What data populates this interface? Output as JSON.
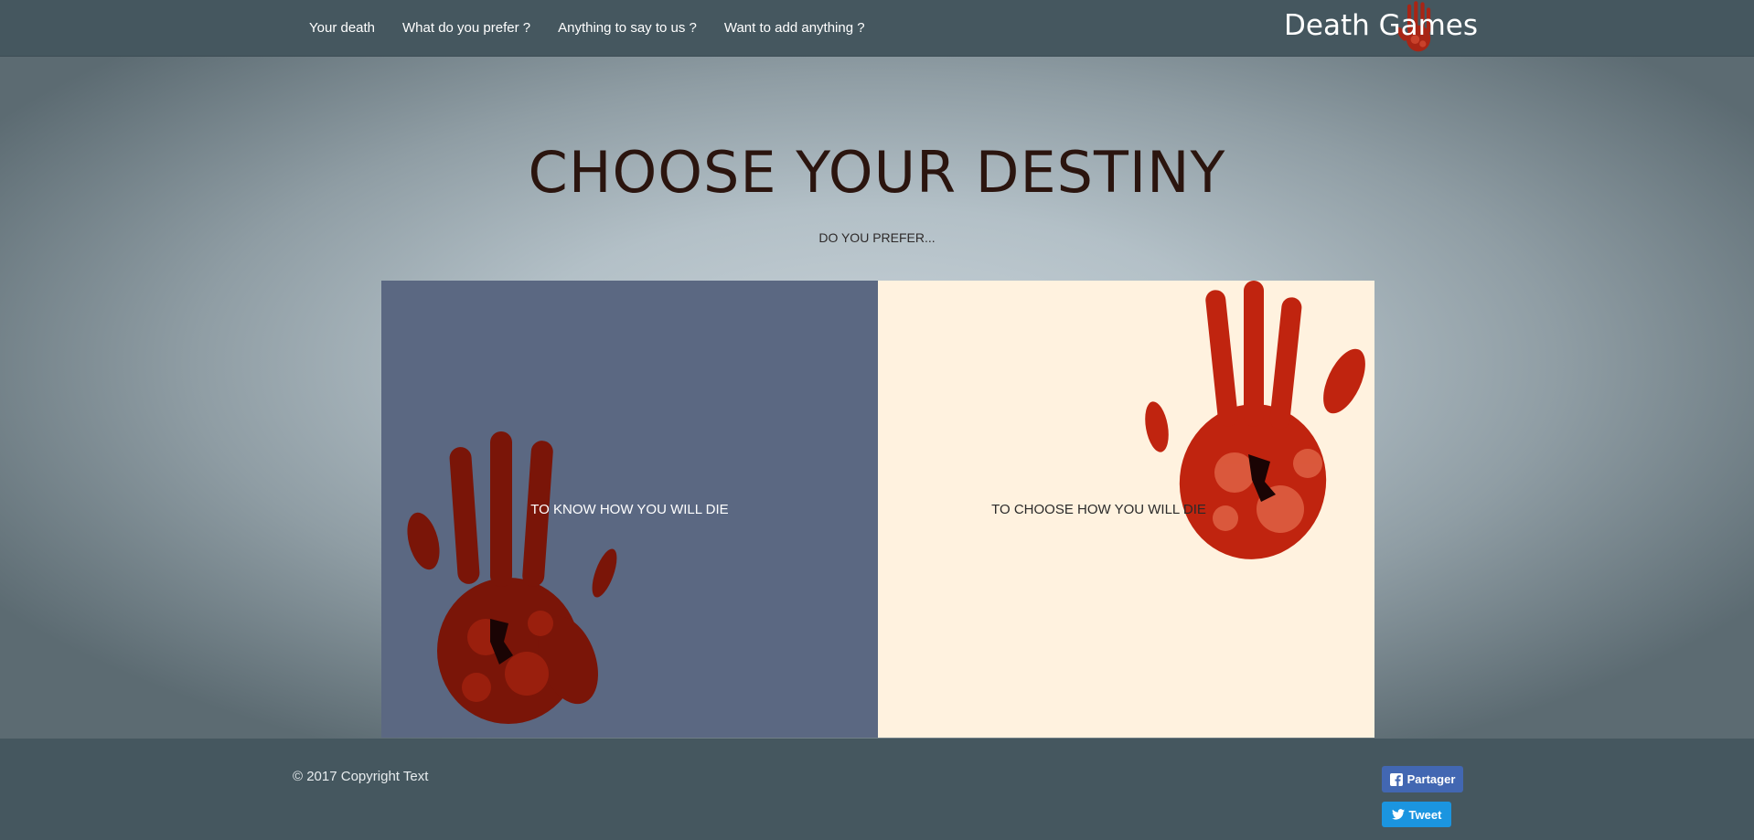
{
  "nav": {
    "links": [
      "Your death",
      "What do you prefer ?",
      "Anything to say to us ?",
      "Want to add anything ?"
    ],
    "brand": "Death Games"
  },
  "main": {
    "title": "CHOOSE YOUR DESTINY",
    "subtitle": "DO YOU PREFER...",
    "choices": [
      {
        "label": "TO KNOW HOW YOU WILL DIE",
        "bg": "#5b6882"
      },
      {
        "label": "TO CHOOSE HOW YOU WILL DIE",
        "bg": "#fff2df"
      }
    ]
  },
  "footer": {
    "copyright": "© 2017 Copyright Text",
    "share_label": "Partager",
    "tweet_label": "Tweet"
  },
  "colors": {
    "nav_bg": "#45575f",
    "facebook": "#4267b2",
    "twitter": "#1b95e0",
    "blood": "#b3200e"
  },
  "icons": [
    "handprint-icon",
    "facebook-icon",
    "twitter-icon"
  ]
}
